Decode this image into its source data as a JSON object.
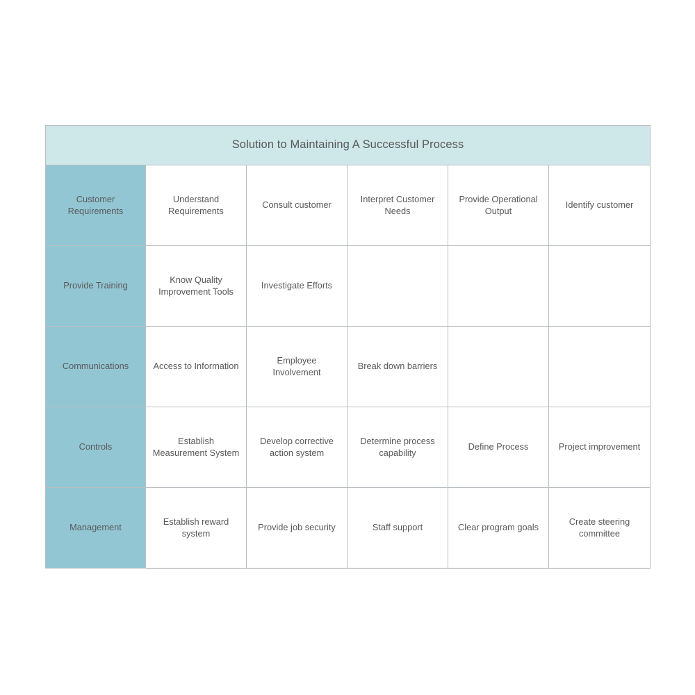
{
  "title": "Solution to Maintaining A Successful Process",
  "colors": {
    "title_background": "#cee7e8",
    "row_label_background": "#93c6d3",
    "cell_background": "#ffffff",
    "grid_line": "#cdd0d2",
    "outer_border": "#b9bec2",
    "text": "#6a6b6d"
  },
  "layout": {
    "columns": 6,
    "rows": 5
  },
  "rows": [
    {
      "label": "Customer\nRequirements",
      "cells": [
        "Understand\nRequirements",
        "Consult customer",
        "Interpret Customer\nNeeds",
        "Provide Operational\nOutput",
        "Identify customer"
      ]
    },
    {
      "label": "Provide Training",
      "cells": [
        "Know Quality\nImprovement Tools",
        "Investigate Efforts",
        "",
        "",
        ""
      ]
    },
    {
      "label": "Communications",
      "cells": [
        "Access to Information",
        "Employee\nInvolvement",
        "Break down barriers",
        "",
        ""
      ]
    },
    {
      "label": "Controls",
      "cells": [
        "Establish\nMeasurement System",
        "Develop corrective\naction system",
        "Determine process\ncapability",
        "Define Process",
        "Project improvement"
      ]
    },
    {
      "label": "Management",
      "cells": [
        "Establish reward\nsystem",
        "Provide job security",
        "Staff support",
        "Clear program goals",
        "Create steering\ncommittee"
      ]
    }
  ]
}
